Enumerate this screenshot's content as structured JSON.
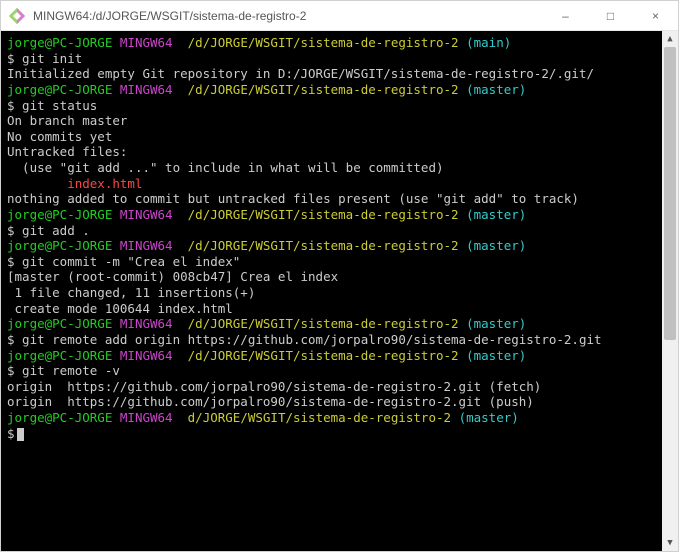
{
  "window": {
    "title": "MINGW64:/d/JORGE/WSGIT/sistema-de-registro-2",
    "min_label": "–",
    "max_label": "□",
    "close_label": "×"
  },
  "prompt": {
    "user": "jorge@PC-JORGE",
    "host": "MINGW64",
    "path": "/d/JORGE/WSGIT/sistema-de-registro-2",
    "path_alt": "d/JORGE/WSGIT/sistema-de-registro-2",
    "branch_main": "(main)",
    "branch_master": "(master)",
    "dollar": "$"
  },
  "blocks": [
    {
      "cmd": "git init",
      "out": [
        "Initialized empty Git repository in D:/JORGE/WSGIT/sistema-de-registro-2/.git/"
      ]
    },
    {
      "cmd": "git status",
      "out": [
        "On branch master",
        "",
        "No commits yet",
        "",
        "Untracked files:",
        "  (use \"git add <file>...\" to include in what will be committed)",
        "        index.html",
        "",
        "nothing added to commit but untracked files present (use \"git add\" to track)"
      ],
      "red_line_index": 6
    },
    {
      "cmd": "git add ."
    },
    {
      "cmd": "git commit -m \"Crea el index\"",
      "out": [
        "[master (root-commit) 008cb47] Crea el index",
        " 1 file changed, 11 insertions(+)",
        " create mode 100644 index.html"
      ]
    },
    {
      "cmd": "git remote add origin https://github.com/jorpalro90/sistema-de-registro-2.git"
    },
    {
      "cmd": "git remote -v",
      "out": [
        "origin  https://github.com/jorpalro90/sistema-de-registro-2.git (fetch)",
        "origin  https://github.com/jorpalro90/sistema-de-registro-2.git (push)"
      ]
    }
  ]
}
